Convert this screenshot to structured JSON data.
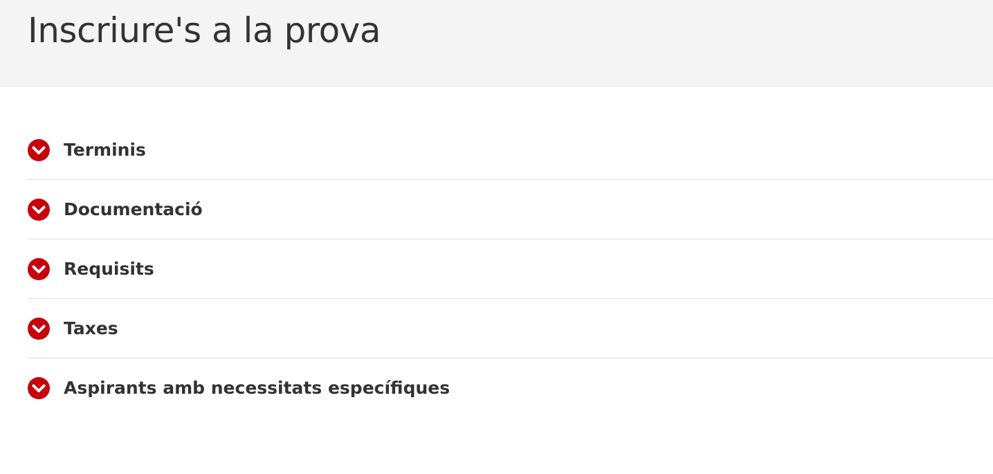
{
  "header": {
    "title": "Inscriure's a la prova"
  },
  "accordion": {
    "icon": "chevron-down-icon",
    "accent_color": "#c8000a",
    "items": [
      {
        "label": "Terminis"
      },
      {
        "label": "Documentació"
      },
      {
        "label": "Requisits"
      },
      {
        "label": "Taxes"
      },
      {
        "label": "Aspirants amb necessitats específiques"
      }
    ]
  }
}
